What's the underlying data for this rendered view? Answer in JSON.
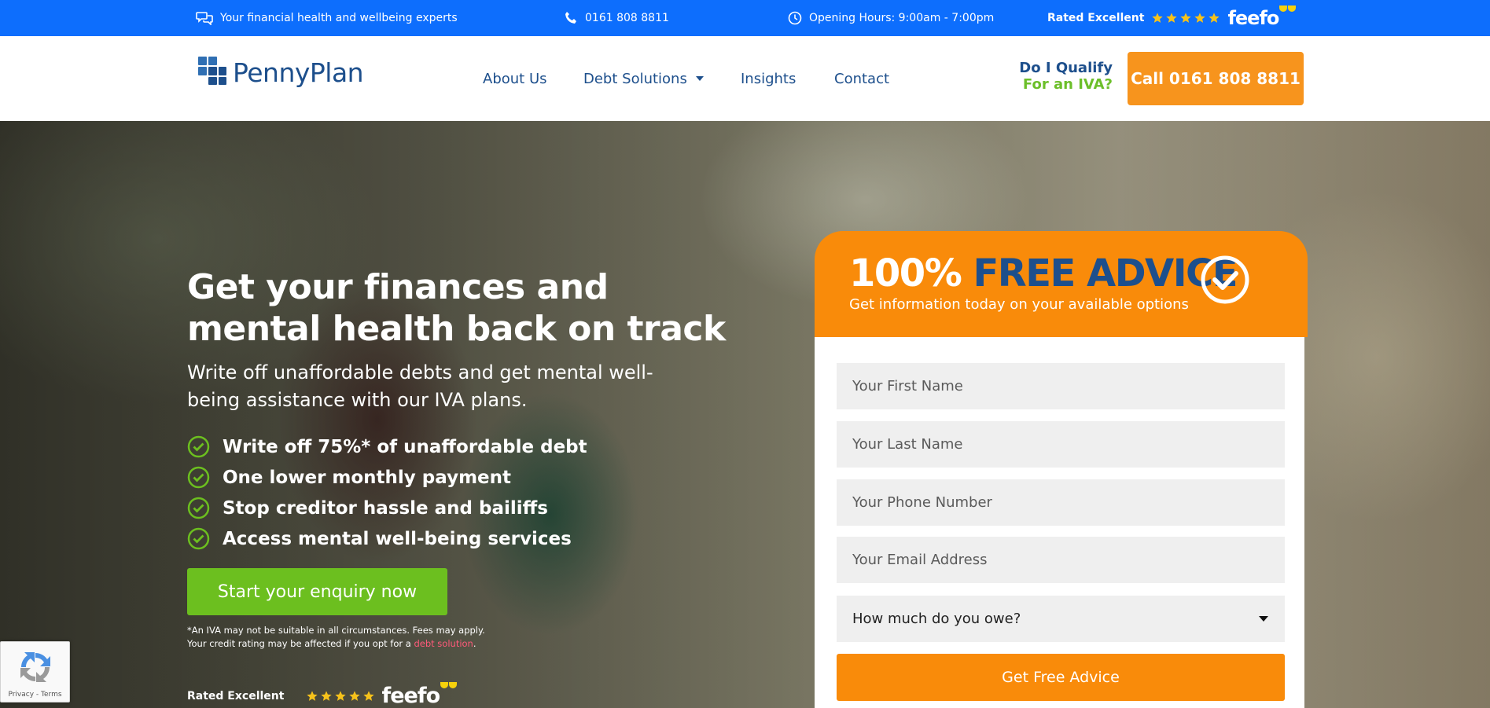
{
  "topbar": {
    "tagline": "Your financial health and wellbeing experts",
    "phone": "0161 808 8811",
    "hours": "Opening Hours: 9:00am - 7:00pm",
    "rated": "Rated Excellent",
    "feefo": "feefo",
    "star_color": "#f6c21b"
  },
  "header": {
    "logo_text": "PennyPlan",
    "nav": {
      "about": "About Us",
      "debt": "Debt Solutions",
      "insights": "Insights",
      "contact": "Contact"
    },
    "qualify_line1": "Do I Qualify",
    "qualify_line2": "For an IVA?",
    "call_button": "Call 0161 808 8811"
  },
  "hero": {
    "title": "Get your finances and mental health back on track",
    "subtitle": "Write off unaffordable debts and get mental well-being assistance with our IVA plans.",
    "bullets": [
      "Write off 75%* of unaffordable debt",
      "One lower monthly payment",
      "Stop creditor hassle and bailiffs",
      "Access mental well-being services"
    ],
    "cta": "Start your enquiry now",
    "disclaimer_line1": "*An IVA may not be suitable in all circumstances. Fees may apply.",
    "disclaimer_line2": "Your credit rating may be affected if you opt for a",
    "disclaimer_link": "debt solution",
    "disclaimer_end": ".",
    "rated": "Rated Excellent",
    "feefo": "feefo"
  },
  "form": {
    "title_white": "100%",
    "title_blue": "FREE ADVICE",
    "subtitle": "Get information today on your available options",
    "first_name_placeholder": "Your First Name",
    "last_name_placeholder": "Your Last Name",
    "phone_placeholder": "Your Phone Number",
    "email_placeholder": "Your Email Address",
    "owe_select": "How much do you owe?",
    "submit": "Get Free Advice"
  },
  "recaptcha": {
    "privacy": "Privacy",
    "terms": "Terms"
  },
  "colors": {
    "topbar": "#0d6efd",
    "brand_blue": "#1d4f8c",
    "orange": "#f98b0a",
    "green": "#6cbf1f"
  }
}
